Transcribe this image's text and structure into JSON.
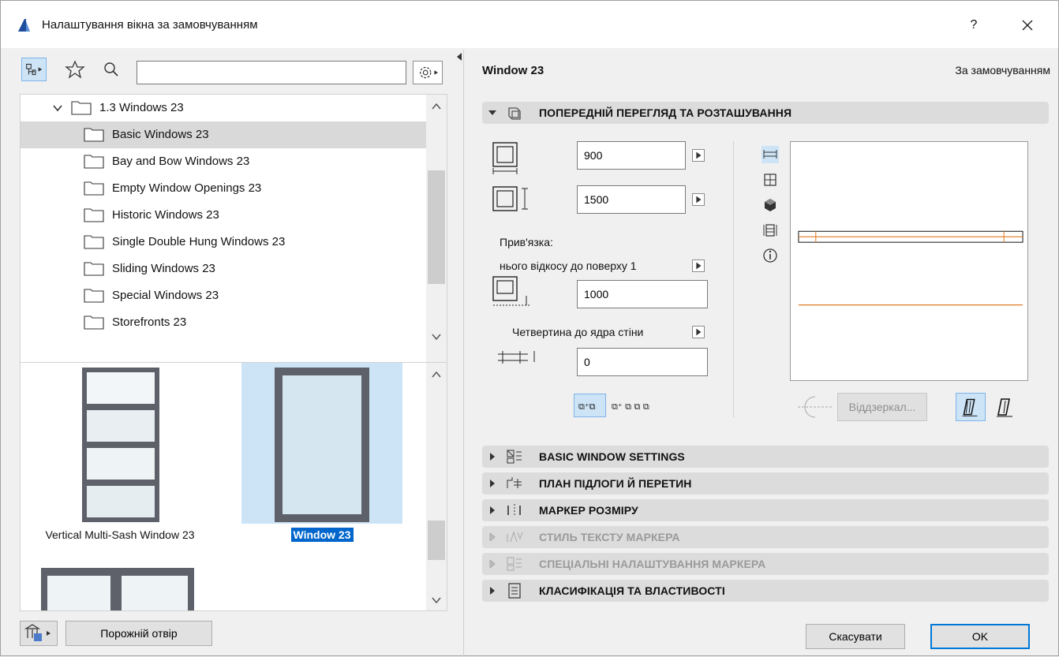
{
  "window": {
    "title": "Налаштування вікна за замовчуванням",
    "help": "?",
    "close_icon": "close-icon"
  },
  "left": {
    "search": {
      "value": "",
      "placeholder": ""
    },
    "tree": [
      {
        "label": "1.3 Windows 23",
        "expanded": true,
        "selected": false
      },
      {
        "label": "Basic Windows 23",
        "selected": true
      },
      {
        "label": "Bay and Bow Windows 23",
        "selected": false
      },
      {
        "label": "Empty Window Openings 23",
        "selected": false
      },
      {
        "label": "Historic Windows 23",
        "selected": false
      },
      {
        "label": "Single Double Hung Windows 23",
        "selected": false
      },
      {
        "label": "Sliding Windows 23",
        "selected": false
      },
      {
        "label": "Special Windows 23",
        "selected": false
      },
      {
        "label": "Storefronts 23",
        "selected": false
      }
    ],
    "thumbnails": [
      {
        "label": "Vertical Multi-Sash Window 23",
        "selected": false
      },
      {
        "label": "Window 23",
        "selected": true
      }
    ],
    "empty_opening_button": "Порожній отвір"
  },
  "right": {
    "object_name": "Window 23",
    "default_label": "За замовчуванням",
    "preview_section": "ПОПЕРЕДНІЙ ПЕРЕГЛЯД ТА РОЗТАШУВАННЯ",
    "width_value": "900",
    "height_value": "1500",
    "anchor_label": "Прив'язка:",
    "anchor_option": "нього відкосу до поверху 1",
    "sill_value": "1000",
    "reveal_option": "Четвертина до ядра стіни",
    "offset_value": "0",
    "mirror_button": "Віддзеркал...",
    "sections": [
      {
        "label": "BASIC WINDOW SETTINGS",
        "enabled": true
      },
      {
        "label": "ПЛАН ПІДЛОГИ Й ПЕРЕТИН",
        "enabled": true
      },
      {
        "label": "МАРКЕР РОЗМІРУ",
        "enabled": true
      },
      {
        "label": "СТИЛЬ ТЕКСТУ МАРКЕРА",
        "enabled": false
      },
      {
        "label": "СПЕЦІАЛЬНІ НАЛАШТУВАННЯ МАРКЕРА",
        "enabled": false
      },
      {
        "label": "КЛАСИФІКАЦІЯ ТА ВЛАСТИВОСТІ",
        "enabled": true
      }
    ],
    "cancel_button": "Скасувати",
    "ok_button": "OK"
  },
  "colors": {
    "selection": "#0066cc",
    "thumb_selected_bg": "#cde4f7",
    "plan_line": "#e07a1f",
    "section_bg": "#dcdcdc"
  }
}
